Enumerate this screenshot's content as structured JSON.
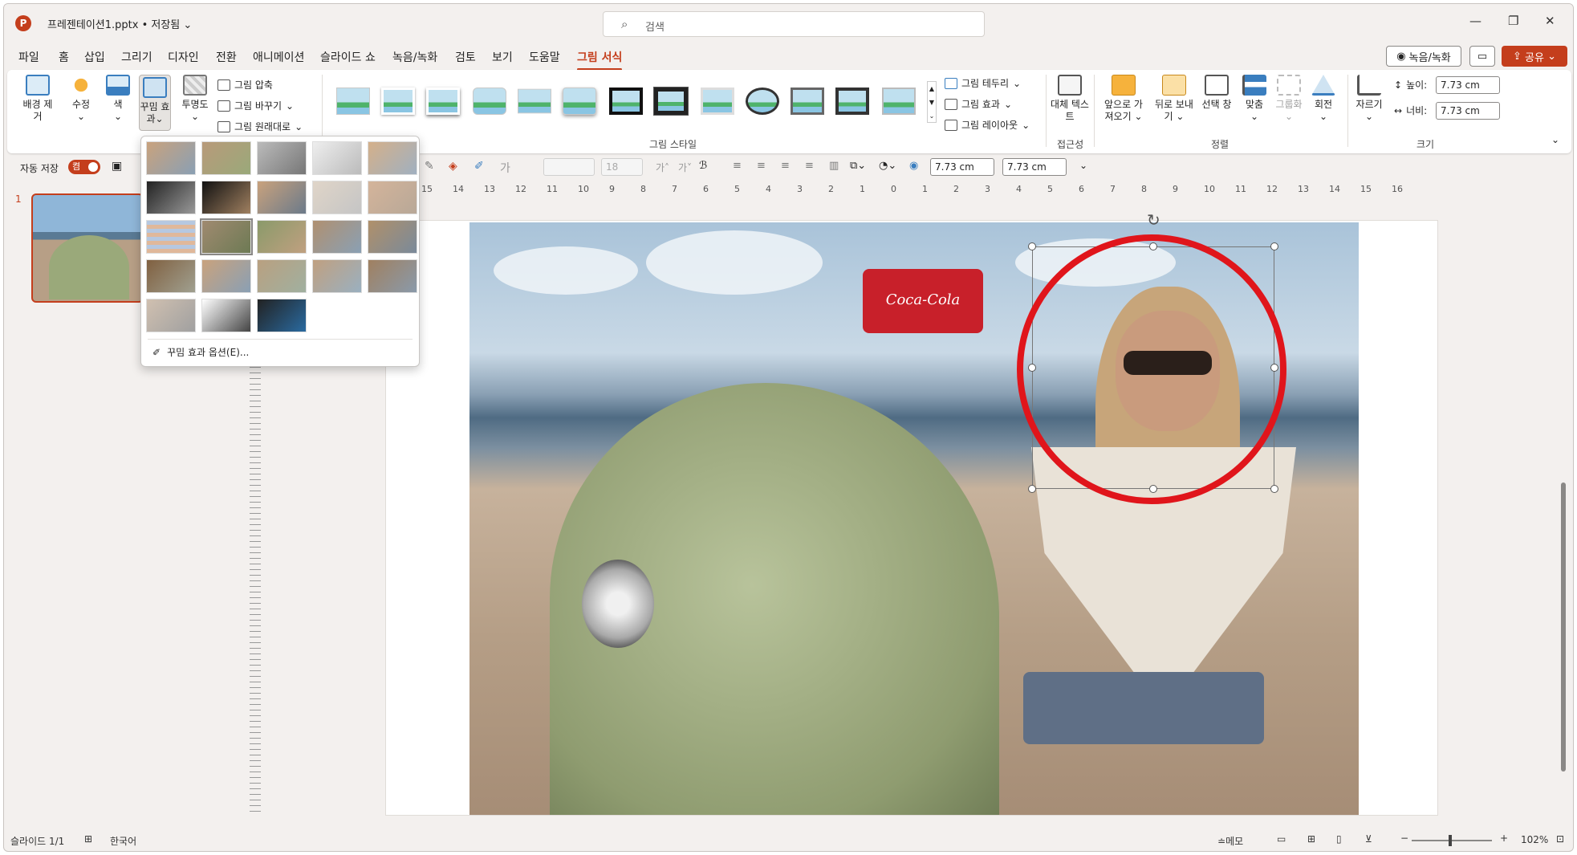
{
  "titlebar": {
    "app_icon": "P",
    "doc_title": "프레젠테이션1.pptx • 저장됨",
    "search_placeholder": "검색"
  },
  "menu": {
    "tabs": [
      "파일",
      "홈",
      "삽입",
      "그리기",
      "디자인",
      "전환",
      "애니메이션",
      "슬라이드 쇼",
      "녹음/녹화",
      "검토",
      "보기",
      "도움말",
      "그림 서식"
    ],
    "active_tab": "그림 서식",
    "record_label": "녹음/녹화",
    "share_label": "공유"
  },
  "ribbon": {
    "adjust": {
      "remove_bg": "배경 제거",
      "corrections": "수정",
      "color": "색",
      "artistic": "꾸밈 효과",
      "transparency": "투명도",
      "compress": "그림 압축",
      "change": "그림 바꾸기",
      "reset": "그림 원래대로"
    },
    "styles_label": "그림 스타일",
    "border": "그림 테두리",
    "effects": "그림 효과",
    "layout": "그림 레이아웃",
    "alt_text": "대체 텍스트",
    "accessibility_label": "접근성",
    "bring_forward": "앞으로 가져오기",
    "send_backward": "뒤로 보내기",
    "selection_pane": "선택 창",
    "align": "맞춤",
    "group": "그룹화",
    "rotate": "회전",
    "arrange_label": "정렬",
    "crop": "자르기",
    "height_label": "높이:",
    "height_value": "7.73 cm",
    "width_label": "너비:",
    "width_value": "7.73 cm",
    "size_label": "크기"
  },
  "toolbar2": {
    "autosave": "자동 저장",
    "autosave_state": "켬",
    "font_size": "18",
    "height_value": "7.73 cm",
    "width_value": "7.73 cm"
  },
  "thumbs": {
    "number": "1"
  },
  "slide_image": {
    "cooler_text": "Coca-Cola"
  },
  "dropdown": {
    "options_label": "꾸밈 효과 옵션(E)...",
    "effect_count": 23
  },
  "ruler": {
    "labels": [
      "15",
      "14",
      "13",
      "12",
      "11",
      "10",
      "9",
      "8",
      "7",
      "6",
      "5",
      "4",
      "3",
      "2",
      "1",
      "0",
      "1",
      "2",
      "3",
      "4",
      "5",
      "6",
      "7",
      "8",
      "9",
      "10",
      "11",
      "12",
      "13",
      "14",
      "15",
      "16"
    ]
  },
  "status": {
    "slide_info": "슬라이드 1/1",
    "language": "한국어",
    "notes": "메모",
    "zoom": "102%"
  },
  "colors": {
    "accent": "#c43e1c",
    "highlight_circle": "#e0151b"
  }
}
